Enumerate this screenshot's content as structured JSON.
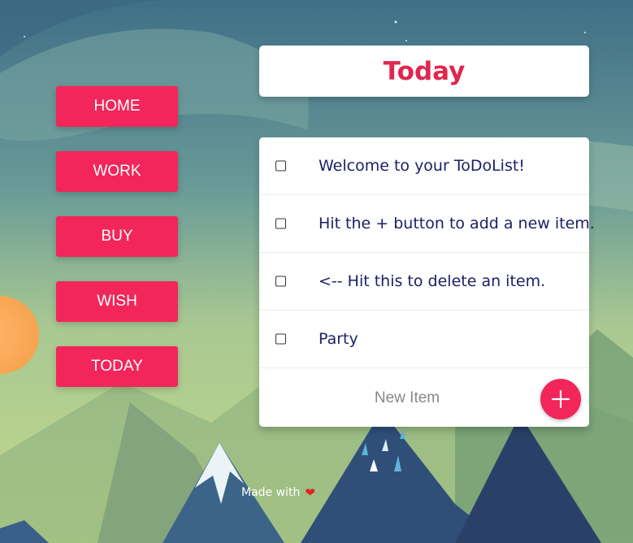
{
  "nav": {
    "items": [
      {
        "label": "HOME"
      },
      {
        "label": "WORK"
      },
      {
        "label": "BUY"
      },
      {
        "label": "WISH"
      },
      {
        "label": "TODAY"
      }
    ]
  },
  "list": {
    "title": "Today",
    "items": [
      {
        "text": "Welcome to your ToDoList!",
        "checked": false
      },
      {
        "text": "Hit the + button to add a new item.",
        "checked": false
      },
      {
        "text": "<-- Hit this to delete an item.",
        "checked": false
      },
      {
        "text": "Party",
        "checked": false
      }
    ],
    "new_item_placeholder": "New Item",
    "add_icon": "plus-icon"
  },
  "footer": {
    "text": "Made with",
    "icon": "heart-icon",
    "heart_glyph": "❤"
  },
  "colors": {
    "accent": "#f2265a",
    "title": "#e0264f",
    "item_text": "#1e2066"
  }
}
